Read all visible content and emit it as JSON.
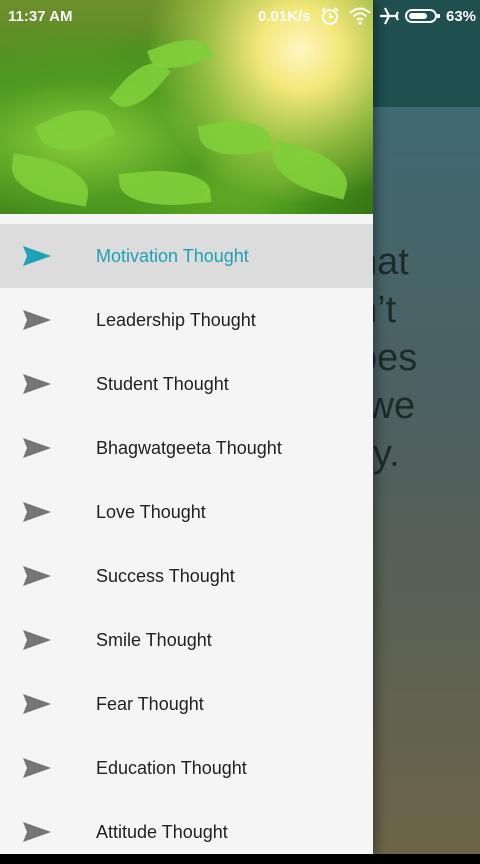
{
  "status_bar": {
    "time": "11:37 AM",
    "speed": "0.01K/s",
    "battery": "63%",
    "icons": [
      "alarm-icon",
      "wifi-icon",
      "airplane-icon",
      "battery-icon"
    ]
  },
  "background": {
    "quote_partial": "hat\nn’t\noes\n we\nily."
  },
  "drawer": {
    "menu_items": [
      {
        "label": "Motivation Thought",
        "active": true
      },
      {
        "label": "Leadership Thought",
        "active": false
      },
      {
        "label": "Student Thought",
        "active": false
      },
      {
        "label": "Bhagwatgeeta Thought",
        "active": false
      },
      {
        "label": "Love Thought",
        "active": false
      },
      {
        "label": "Success Thought",
        "active": false
      },
      {
        "label": "Smile Thought",
        "active": false
      },
      {
        "label": "Fear Thought",
        "active": false
      },
      {
        "label": "Education Thought",
        "active": false
      },
      {
        "label": "Attitude Thought",
        "active": false
      }
    ]
  },
  "colors": {
    "accent": "#1fa1b6",
    "active_bg": "#dcdcdc",
    "toolbar": "#1f4f4f",
    "icon_gray": "#757575"
  }
}
